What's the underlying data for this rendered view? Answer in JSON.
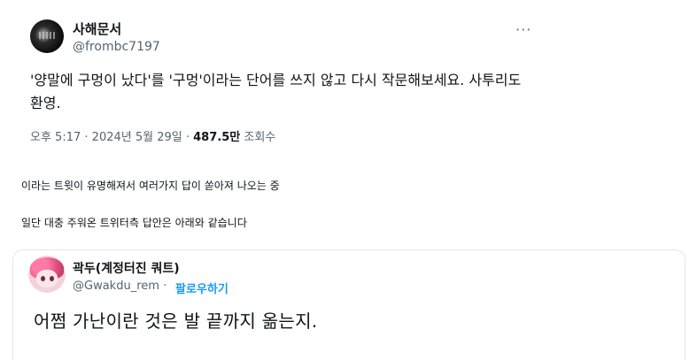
{
  "tweet": {
    "author_name": "사해문서",
    "author_handle": "@frombc7197",
    "more_icon": "···",
    "text": "'양말에 구멍이 났다'를 '구멍'이라는 단어를 쓰지 않고 다시 작문해보세요. 사투리도 환영.",
    "time": "오후 5:17",
    "date": "2024년 5월 29일",
    "sep": "·",
    "views_count": "487.5만",
    "views_label": "조회수"
  },
  "captions": [
    "이라는 트윗이 유명해져서 여러가지 답이 쏟아져 나오는 중",
    "일단 대충 주워온 트위터측 답안은 아래와 같습니다"
  ],
  "quote": {
    "author_name": "곽두(계정터진 쿼트)",
    "author_handle": "@Gwakdu_rem",
    "sep": "·",
    "follow_label": "팔로우하기",
    "text": "어쩜 가난이란 것은 발 끝까지 옮는지."
  }
}
